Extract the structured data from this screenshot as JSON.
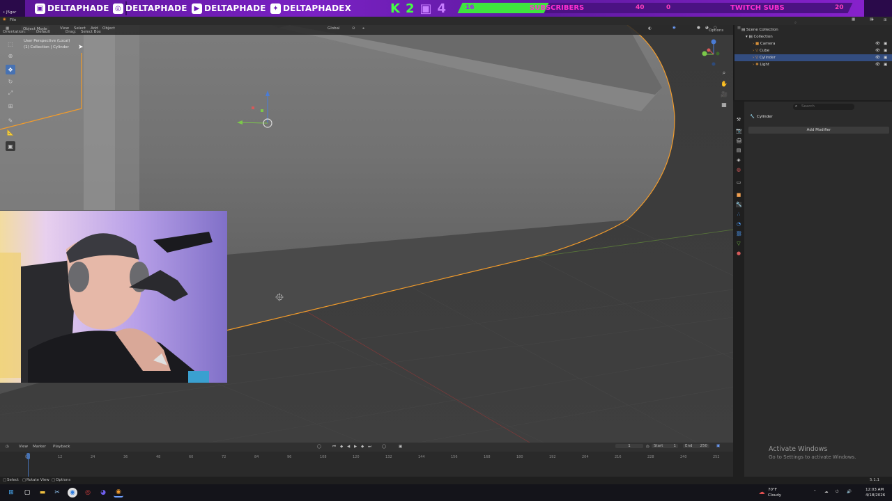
{
  "overlay": {
    "handles": [
      "DELTAPHADE",
      "DELTAPHADE",
      "DELTAPHADE",
      "DELTAPHADEX"
    ],
    "social_icons": [
      "twitch-icon",
      "instagram-icon",
      "youtube-icon",
      "twitter-icon"
    ],
    "kick_count": "2",
    "twitch_count": "4",
    "subs_current": "16",
    "subs_label": "SUBSCRIBERS",
    "subs_goal": "40",
    "twitch_subs_current": "0",
    "twitch_subs_label": "TWITCH SUBS",
    "twitch_subs_goal": "20",
    "subs_progress": 0.4,
    "twitch_subs_progress": 0.0
  },
  "window": {
    "title": "• J5gar",
    "menu_file": "File"
  },
  "header": {
    "mode": "Object Mode",
    "menus": [
      "View",
      "Select",
      "Add",
      "Object"
    ],
    "orientation_label": "Orientation:",
    "orientation_value": "Default",
    "drag_label": "Drag:",
    "drag_value": "Select Box",
    "transform_value": "Global",
    "options_label": "Options"
  },
  "viewport": {
    "perspective": "User Perspective (Local)",
    "collection_path": "(1) Collection | Cylinder"
  },
  "outliner": {
    "root": "Scene Collection",
    "collection": "Collection",
    "items": [
      "Camera",
      "Cube",
      "Cylinder",
      "Light"
    ],
    "selected": "Cylinder"
  },
  "properties": {
    "search_placeholder": "Search",
    "object_name": "Cylinder",
    "add_modifier": "Add Modifier"
  },
  "timeline": {
    "menus": [
      "View",
      "Marker",
      "Playback"
    ],
    "current_frame": "1",
    "start_label": "Start",
    "start_value": "1",
    "end_label": "End",
    "end_value": "250",
    "ticks": [
      "0",
      "12",
      "24",
      "36",
      "48",
      "60",
      "72",
      "84",
      "96",
      "108",
      "120",
      "132",
      "144",
      "156",
      "168",
      "180",
      "192",
      "204",
      "216",
      "228",
      "240",
      "252"
    ]
  },
  "statusbar": {
    "hints": [
      "Select",
      "Rotate View",
      "Options"
    ],
    "version": "5.1.1"
  },
  "watermark": {
    "title": "Activate Windows",
    "subtitle": "Go to Settings to activate Windows."
  },
  "taskbar": {
    "weather_temp": "70°F",
    "weather_desc": "Cloudy",
    "time": "12:03 AM",
    "date": "4/18/2026"
  },
  "colors": {
    "selection_outline": "#f39c2b",
    "accent_blue": "#4772b3",
    "overlay_purple": "#6b1ab5",
    "kick_green": "#44ff44"
  }
}
